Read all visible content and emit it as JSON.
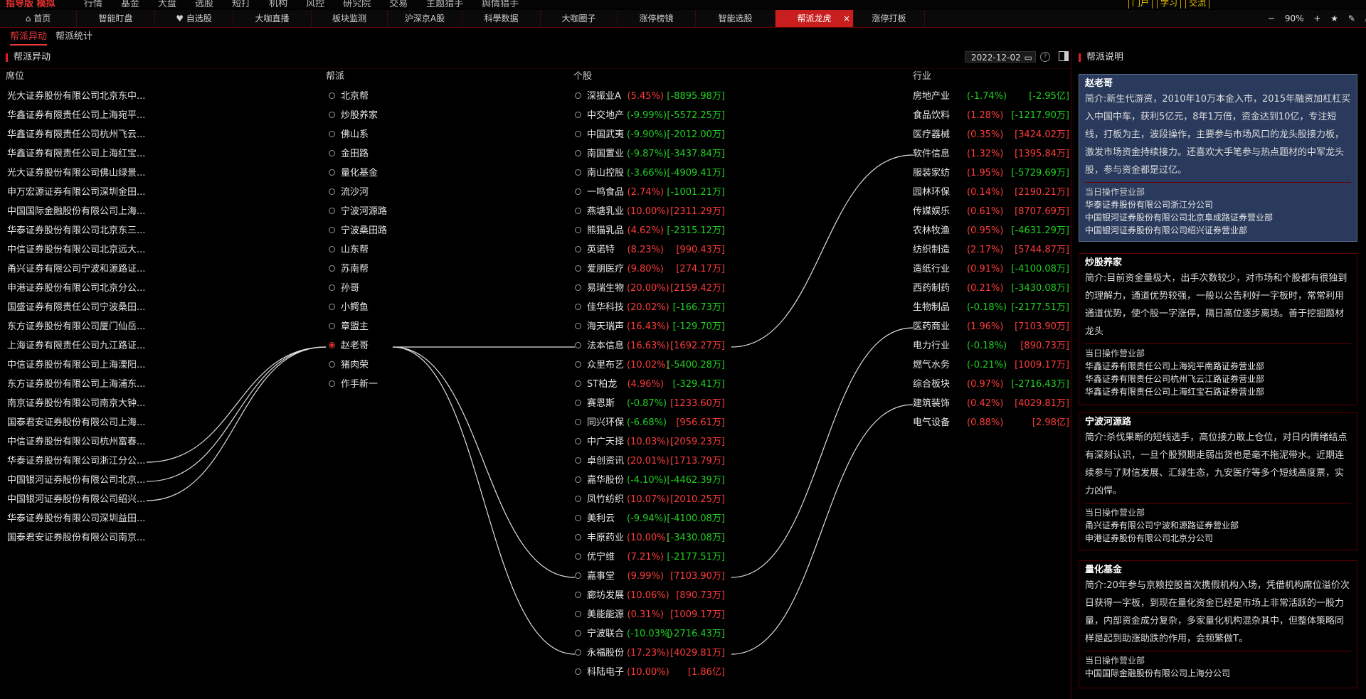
{
  "app": {
    "logo": "指导版 模拟",
    "menu": [
      "行情",
      "基金",
      "大盘",
      "选股",
      "短打",
      "机构",
      "风控",
      "研究院",
      "交易",
      "主题猎手",
      "舆情猎手"
    ],
    "right_buttons": [
      "门户",
      "学习",
      "交流"
    ]
  },
  "tabs": [
    "首页",
    "智能盯盘",
    "自选股",
    "大咖直播",
    "板块监测",
    "沪深京A股",
    "科學数据",
    "大咖圈子",
    "涨停榜镜",
    "智能选股",
    "帮派龙虎",
    "涨停打板"
  ],
  "active_tab": "帮派龙虎",
  "zoom": "90%",
  "subtabs": [
    "帮派异动",
    "帮派统计"
  ],
  "panel_title": "帮派异动",
  "date": "2022-12-02",
  "columns": {
    "seat": "席位",
    "gang": "帮派",
    "stock": "个股",
    "industry": "行业"
  },
  "seats": [
    "光大证券股份有限公司北京东中...",
    "华鑫证券有限责任公司上海宛平...",
    "华鑫证券有限责任公司杭州飞云...",
    "华鑫证券有限责任公司上海红宝...",
    "光大证券股份有限公司佛山绿景...",
    "申万宏源证券有限公司深圳金田...",
    "中国国际金融股份有限公司上海...",
    "华泰证券股份有限公司北京东三...",
    "中信证券股份有限公司北京远大...",
    "甬兴证券有限公司宁波和源路证...",
    "申港证券股份有限公司北京分公...",
    "国盛证券有限责任公司宁波桑田...",
    "东方证券股份有限公司厦门仙岳...",
    "上海证券有限责任公司九江路证...",
    "中信证券股份有限公司上海溧阳...",
    "东方证券股份有限公司上海浦东...",
    "南京证券股份有限公司南京大钟...",
    "国泰君安证券股份有限公司上海...",
    "中信证券股份有限公司杭州富春...",
    "华泰证券股份有限公司浙江分公...",
    "中国银河证券股份有限公司北京...",
    "中国银河证券股份有限公司绍兴...",
    "华泰证券股份有限公司深圳益田...",
    "国泰君安证券股份有限公司南京..."
  ],
  "gangs": [
    "北京帮",
    "炒股养家",
    "佛山系",
    "金田路",
    "量化基金",
    "流沙河",
    "宁波河源路",
    "宁波桑田路",
    "山东帮",
    "苏南帮",
    "孙哥",
    "小鳄鱼",
    "章盟主",
    "赵老哥",
    "猪肉荣",
    "作手新一"
  ],
  "selected_gang": "赵老哥",
  "stocks": [
    {
      "name": "深振业A",
      "pct": "(5.45%)",
      "amt": "[-8895.98万]",
      "pc": "red",
      "ac": "green"
    },
    {
      "name": "中交地产",
      "pct": "(-9.99%)",
      "amt": "[-5572.25万]",
      "pc": "green",
      "ac": "green"
    },
    {
      "name": "中国武夷",
      "pct": "(-9.90%)",
      "amt": "[-2012.00万]",
      "pc": "green",
      "ac": "green"
    },
    {
      "name": "南国置业",
      "pct": "(-9.87%)",
      "amt": "[-3437.84万]",
      "pc": "green",
      "ac": "green"
    },
    {
      "name": "南山控股",
      "pct": "(-3.66%)",
      "amt": "[-4909.41万]",
      "pc": "green",
      "ac": "green"
    },
    {
      "name": "一鸣食品",
      "pct": "(2.74%)",
      "amt": "[-1001.21万]",
      "pc": "red",
      "ac": "green"
    },
    {
      "name": "燕塘乳业",
      "pct": "(10.00%)",
      "amt": "[2311.29万]",
      "pc": "red",
      "ac": "red"
    },
    {
      "name": "熊猫乳品",
      "pct": "(4.62%)",
      "amt": "[-2315.12万]",
      "pc": "red",
      "ac": "green"
    },
    {
      "name": "英诺特",
      "pct": "(8.23%)",
      "amt": "[990.43万]",
      "pc": "red",
      "ac": "red"
    },
    {
      "name": "爱朋医疗",
      "pct": "(9.80%)",
      "amt": "[274.17万]",
      "pc": "red",
      "ac": "red"
    },
    {
      "name": "易瑞生物",
      "pct": "(20.00%)",
      "amt": "[2159.42万]",
      "pc": "red",
      "ac": "red"
    },
    {
      "name": "佳华科技",
      "pct": "(20.02%)",
      "amt": "[-166.73万]",
      "pc": "red",
      "ac": "green"
    },
    {
      "name": "海天瑞声",
      "pct": "(16.43%)",
      "amt": "[-129.70万]",
      "pc": "red",
      "ac": "green"
    },
    {
      "name": "法本信息",
      "pct": "(16.63%)",
      "amt": "[1692.27万]",
      "pc": "red",
      "ac": "red"
    },
    {
      "name": "众里布艺",
      "pct": "(10.02%)",
      "amt": "[-5400.28万]",
      "pc": "red",
      "ac": "green"
    },
    {
      "name": "ST柏龙",
      "pct": "(4.96%)",
      "amt": "[-329.41万]",
      "pc": "red",
      "ac": "green"
    },
    {
      "name": "赛恩斯",
      "pct": "(-0.87%)",
      "amt": "[1233.60万]",
      "pc": "green",
      "ac": "red"
    },
    {
      "name": "同兴环保",
      "pct": "(-6.68%)",
      "amt": "[956.61万]",
      "pc": "green",
      "ac": "red"
    },
    {
      "name": "中广天择",
      "pct": "(10.03%)",
      "amt": "[2059.23万]",
      "pc": "red",
      "ac": "red"
    },
    {
      "name": "卓创资讯",
      "pct": "(20.01%)",
      "amt": "[1713.79万]",
      "pc": "red",
      "ac": "red"
    },
    {
      "name": "嘉华股份",
      "pct": "(-4.10%)",
      "amt": "[-4462.39万]",
      "pc": "green",
      "ac": "green"
    },
    {
      "name": "凤竹纺织",
      "pct": "(10.07%)",
      "amt": "[2010.25万]",
      "pc": "red",
      "ac": "red"
    },
    {
      "name": "美利云",
      "pct": "(-9.94%)",
      "amt": "[-4100.08万]",
      "pc": "green",
      "ac": "green"
    },
    {
      "name": "丰原药业",
      "pct": "(10.00%)",
      "amt": "[-3430.08万]",
      "pc": "red",
      "ac": "green"
    },
    {
      "name": "优宁维",
      "pct": "(7.21%)",
      "amt": "[-2177.51万]",
      "pc": "red",
      "ac": "green"
    },
    {
      "name": "嘉事堂",
      "pct": "(9.99%)",
      "amt": "[7103.90万]",
      "pc": "red",
      "ac": "red"
    },
    {
      "name": "廊坊发展",
      "pct": "(10.06%)",
      "amt": "[890.73万]",
      "pc": "red",
      "ac": "red"
    },
    {
      "name": "美能能源",
      "pct": "(0.31%)",
      "amt": "[1009.17万]",
      "pc": "red",
      "ac": "red"
    },
    {
      "name": "宁波联合",
      "pct": "(-10.03%)",
      "amt": "[-2716.43万]",
      "pc": "green",
      "ac": "green"
    },
    {
      "name": "永福股份",
      "pct": "(17.23%)",
      "amt": "[4029.81万]",
      "pc": "red",
      "ac": "red"
    },
    {
      "name": "科陆电子",
      "pct": "(10.00%)",
      "amt": "[1.86亿]",
      "pc": "red",
      "ac": "red"
    }
  ],
  "industries": [
    {
      "name": "房地产业",
      "pct": "(-1.74%)",
      "amt": "[-2.95亿]",
      "pc": "green",
      "ac": "green"
    },
    {
      "name": "食品饮料",
      "pct": "(1.28%)",
      "amt": "[-1217.90万]",
      "pc": "red",
      "ac": "green"
    },
    {
      "name": "医疗器械",
      "pct": "(0.35%)",
      "amt": "[3424.02万]",
      "pc": "red",
      "ac": "red"
    },
    {
      "name": "软件信息",
      "pct": "(1.32%)",
      "amt": "[1395.84万]",
      "pc": "red",
      "ac": "red"
    },
    {
      "name": "服装家纺",
      "pct": "(1.95%)",
      "amt": "[-5729.69万]",
      "pc": "red",
      "ac": "green"
    },
    {
      "name": "园林环保",
      "pct": "(0.14%)",
      "amt": "[2190.21万]",
      "pc": "red",
      "ac": "red"
    },
    {
      "name": "传媒娱乐",
      "pct": "(0.61%)",
      "amt": "[8707.69万]",
      "pc": "red",
      "ac": "red"
    },
    {
      "name": "农林牧渔",
      "pct": "(0.95%)",
      "amt": "[-4631.29万]",
      "pc": "red",
      "ac": "green"
    },
    {
      "name": "纺织制造",
      "pct": "(2.17%)",
      "amt": "[5744.87万]",
      "pc": "red",
      "ac": "red"
    },
    {
      "name": "造纸行业",
      "pct": "(0.91%)",
      "amt": "[-4100.08万]",
      "pc": "red",
      "ac": "green"
    },
    {
      "name": "西药制药",
      "pct": "(0.21%)",
      "amt": "[-3430.08万]",
      "pc": "red",
      "ac": "green"
    },
    {
      "name": "生物制品",
      "pct": "(-0.18%)",
      "amt": "[-2177.51万]",
      "pc": "green",
      "ac": "green"
    },
    {
      "name": "医药商业",
      "pct": "(1.96%)",
      "amt": "[7103.90万]",
      "pc": "red",
      "ac": "red"
    },
    {
      "name": "电力行业",
      "pct": "(-0.18%)",
      "amt": "[890.73万]",
      "pc": "green",
      "ac": "red"
    },
    {
      "name": "燃气水务",
      "pct": "(-0.21%)",
      "amt": "[1009.17万]",
      "pc": "green",
      "ac": "red"
    },
    {
      "name": "综合板块",
      "pct": "(0.97%)",
      "amt": "[-2716.43万]",
      "pc": "red",
      "ac": "green"
    },
    {
      "name": "建筑装饰",
      "pct": "(0.42%)",
      "amt": "[4029.81万]",
      "pc": "red",
      "ac": "red"
    },
    {
      "name": "电气设备",
      "pct": "(0.88%)",
      "amt": "[2.98亿]",
      "pc": "red",
      "ac": "red"
    }
  ],
  "links": {
    "seat_to_gang": [
      19,
      20,
      21
    ],
    "gang_to_stock": [
      13,
      25,
      29
    ],
    "stock_to_industry": [
      [
        13,
        3
      ],
      [
        25,
        12
      ],
      [
        29,
        16
      ]
    ]
  },
  "right_panel": {
    "title": "帮派说明",
    "cards": [
      {
        "name": "赵老哥",
        "desc": "简介:新生代游资，2010年10万本金入市，2015年融资加杠杠买入中国中车，获利5亿元，8年1万倍，资金达到10亿，专注短线，打板为主，波段操作，主要参与市场风口的龙头股接力板，激发市场资金持续接力。还喜欢大手笔参与热点题材的中军龙头股，参与资金都是过亿。",
        "op_header": "当日操作营业部",
        "ops": [
          "华泰证券股份有限公司浙江分公司",
          "中国银河证券股份有限公司北京阜成路证券营业部",
          "中国银河证券股份有限公司绍兴证券营业部"
        ]
      },
      {
        "name": "炒股养家",
        "desc": "简介:目前资金量极大，出手次数较少，对市场和个股都有很独到的理解力，通道优势较强，一般以公告利好一字板时，常常利用通道优势，使个股一字涨停，隔日高位逐步离场。善于挖掘题材龙头",
        "op_header": "当日操作营业部",
        "ops": [
          "华鑫证券有限责任公司上海宛平南路证券营业部",
          "华鑫证券有限责任公司杭州飞云江路证券营业部",
          "华鑫证券有限责任公司上海红宝石路证券营业部"
        ]
      },
      {
        "name": "宁波河源路",
        "desc": "简介:杀伐果断的短线选手，高位接力敢上仓位，对日内情绪结点有深刻认识，一旦个股预期走弱出货也是毫不拖泥带水。近期连续参与了财信发展、汇绿生态，九安医疗等多个短线高度票，实力凶悍。",
        "op_header": "当日操作营业部",
        "ops": [
          "甬兴证券有限公司宁波和源路证券营业部",
          "申港证券股份有限公司北京分公司"
        ]
      },
      {
        "name": "量化基金",
        "desc": "简介:20年参与京粮控股首次携假机构入场，凭借机构席位溢价次日获得一字板，到现在量化资金已经是市场上非常活跃的一股力量，内部资金成分复杂，多家量化机构混杂其中，但整体策略同样是起到助涨助跌的作用，会频繁做T。",
        "op_header": "当日操作营业部",
        "ops": [
          "中国国际金融股份有限公司上海分公司"
        ]
      }
    ]
  },
  "colors": {
    "up": "#ff3b3b",
    "down": "#21d021",
    "accent": "#c81e1e",
    "link": "#e0e0e0"
  }
}
